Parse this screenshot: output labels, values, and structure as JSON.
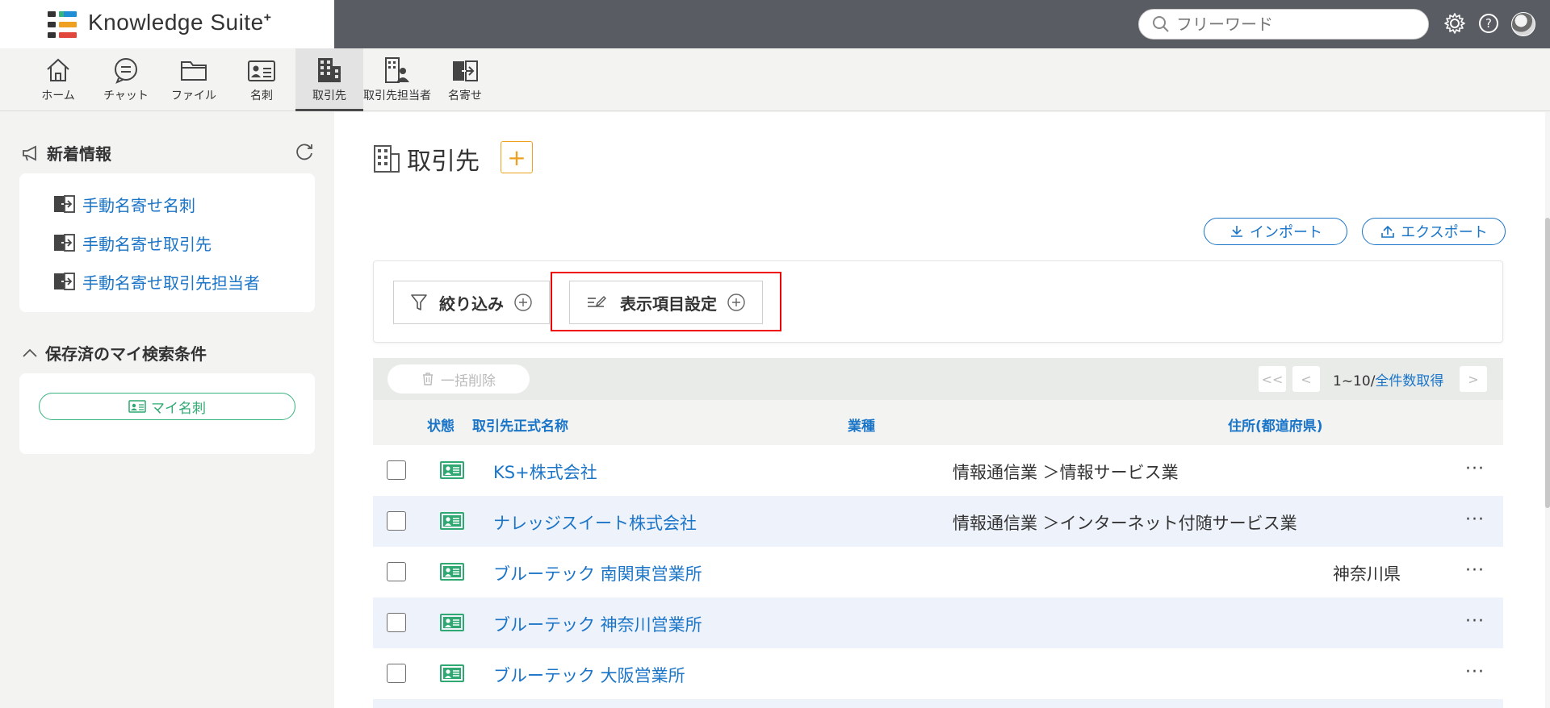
{
  "app": {
    "logo_text": "Knowledge Suite",
    "logo_sup": "+",
    "search_placeholder": "フリーワード"
  },
  "nav": {
    "items": [
      {
        "label": "ホーム",
        "icon": "home-icon"
      },
      {
        "label": "チャット",
        "icon": "chat-icon"
      },
      {
        "label": "ファイル",
        "icon": "folder-icon"
      },
      {
        "label": "名刺",
        "icon": "business-card-icon"
      },
      {
        "label": "取引先",
        "icon": "building-icon"
      },
      {
        "label": "取引先担当者",
        "icon": "building-person-icon"
      },
      {
        "label": "名寄せ",
        "icon": "merge-icon"
      }
    ],
    "active_index": 4
  },
  "sidebar": {
    "news_title": "新着情報",
    "news_items": [
      {
        "label": "手動名寄せ名刺"
      },
      {
        "label": "手動名寄せ取引先"
      },
      {
        "label": "手動名寄せ取引先担当者"
      }
    ],
    "saved_title": "保存済のマイ検索条件",
    "my_card_label": "マイ名刺"
  },
  "main": {
    "page_title": "取引先",
    "add_label": "+",
    "import_label": "インポート",
    "export_label": "エクスポート",
    "filter_label": "絞り込み",
    "columns_setting_label": "表示項目設定",
    "bulk_delete_label": "一括削除",
    "pagination": {
      "range": "1~10/",
      "fetch_all": "全件数取得",
      "first": "<<",
      "prev": "<",
      "next": ">"
    },
    "table": {
      "headers": {
        "status": "状態",
        "name": "取引先正式名称",
        "industry": "業種",
        "prefecture": "住所(都道府県)"
      },
      "rows": [
        {
          "name": "KS+株式会社",
          "industry": "情報通信業 ＞情報サービス業",
          "prefecture": ""
        },
        {
          "name": "ナレッジスイート株式会社",
          "industry": "情報通信業 ＞インターネット付随サービス業",
          "prefecture": ""
        },
        {
          "name": "ブルーテック 南関東営業所",
          "industry": "",
          "prefecture": "神奈川県"
        },
        {
          "name": "ブルーテック 神奈川営業所",
          "industry": "",
          "prefecture": ""
        },
        {
          "name": "ブルーテック 大阪営業所",
          "industry": "",
          "prefecture": ""
        }
      ],
      "more_label": "···"
    }
  },
  "colors": {
    "accent_blue": "#1a74c8",
    "topbar": "#5a5c64",
    "add_orange": "#f0a020",
    "status_green": "#2fa872",
    "highlight_red": "#e00000"
  }
}
